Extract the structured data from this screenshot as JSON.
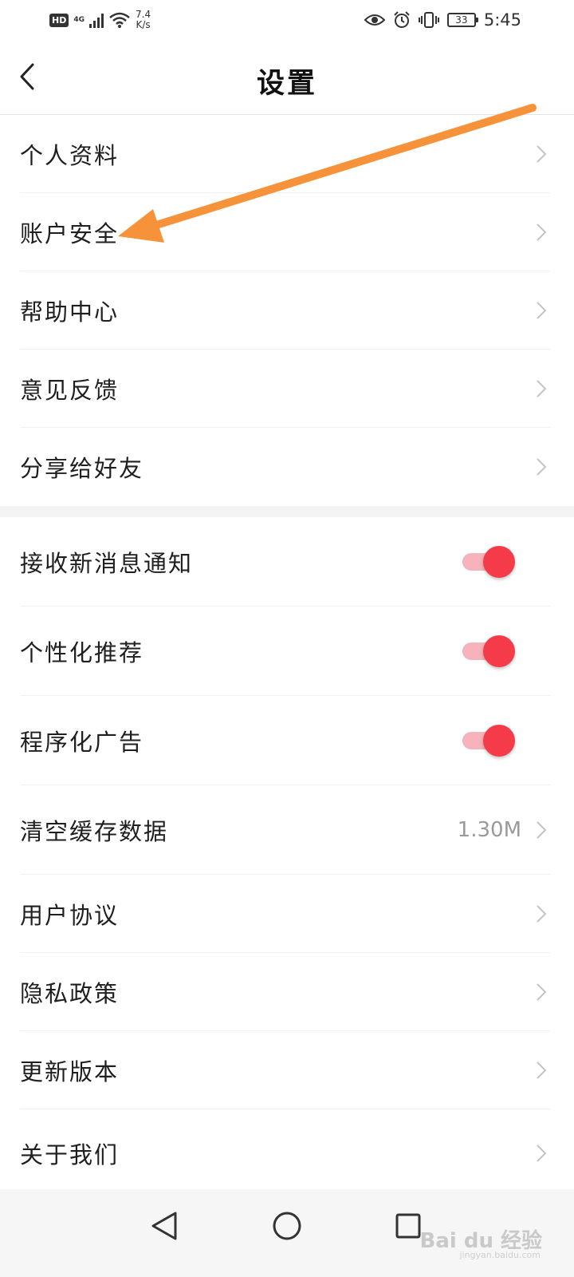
{
  "status_bar": {
    "hd": "HD",
    "network": "4G",
    "speed_value": "7.4",
    "speed_unit": "K/s",
    "battery": "33",
    "time": "5:45"
  },
  "header": {
    "title": "设置"
  },
  "menu_group_1": [
    {
      "label": "个人资料"
    },
    {
      "label": "账户安全"
    },
    {
      "label": "帮助中心"
    },
    {
      "label": "意见反馈"
    },
    {
      "label": "分享给好友"
    }
  ],
  "toggles": [
    {
      "label": "接收新消息通知",
      "on": true
    },
    {
      "label": "个性化推荐",
      "on": true
    },
    {
      "label": "程序化广告",
      "on": true
    }
  ],
  "cache": {
    "label": "清空缓存数据",
    "value": "1.30M"
  },
  "menu_group_2": [
    {
      "label": "用户协议"
    },
    {
      "label": "隐私政策"
    },
    {
      "label": "更新版本"
    },
    {
      "label": "关于我们"
    }
  ],
  "watermark": {
    "brand": "Bai du 经验",
    "url": "jingyan.baidu.com"
  },
  "colors": {
    "toggle_on": "#f53a4a",
    "toggle_track": "#f7b3bb",
    "annotation_arrow": "#f6923a"
  }
}
